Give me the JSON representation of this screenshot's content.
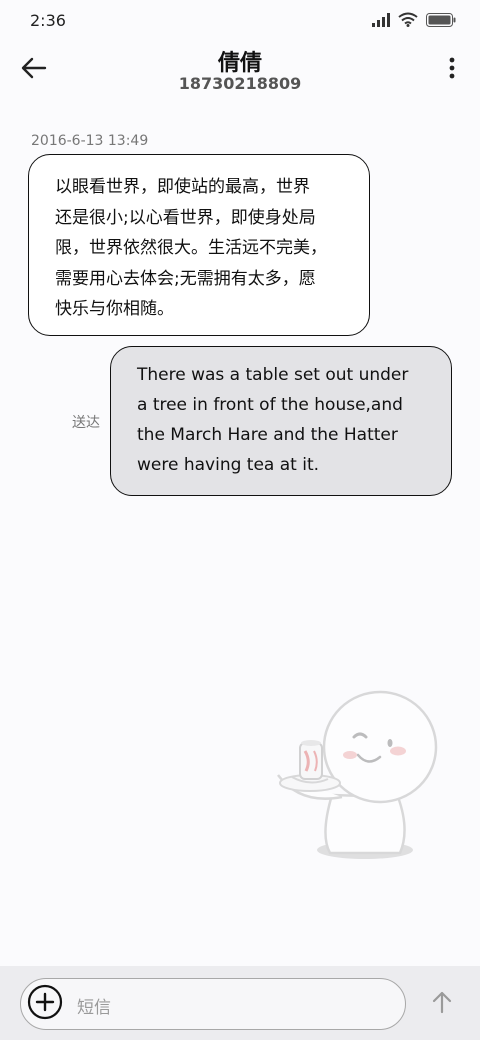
{
  "status_bar": {
    "time": "2:36",
    "icons": [
      "signal-icon",
      "wifi-icon",
      "battery-icon"
    ]
  },
  "header": {
    "back_icon": "back-arrow-icon",
    "contact_name": "倩倩",
    "contact_phone": "18730218809",
    "menu_icon": "more-vertical-icon"
  },
  "conversation": {
    "timestamp": "2016-6-13 13:49",
    "messages": [
      {
        "direction": "incoming",
        "lines": [
          "以眼看世界，即使站的最高，世界",
          "还是很小;以心看世界，即使身处局",
          "限，世界依然很大。生活远不完美，",
          "需要用心去体会;无需拥有太多，愿",
          "快乐与你相随。"
        ]
      },
      {
        "direction": "outgoing",
        "status": "送达",
        "lines": [
          "There was a table set out under",
          "a tree in front of the house,and",
          "the March Hare and the Hatter",
          "were having tea at it."
        ]
      }
    ]
  },
  "input_bar": {
    "add_icon": "add-circle-icon",
    "placeholder": "短信",
    "send_icon": "send-arrow-icon"
  },
  "colors": {
    "background": "#fbfbfd",
    "outgoing_bubble": "#e3e3e6",
    "incoming_bubble": "#ffffff",
    "input_bar": "#ececef"
  }
}
